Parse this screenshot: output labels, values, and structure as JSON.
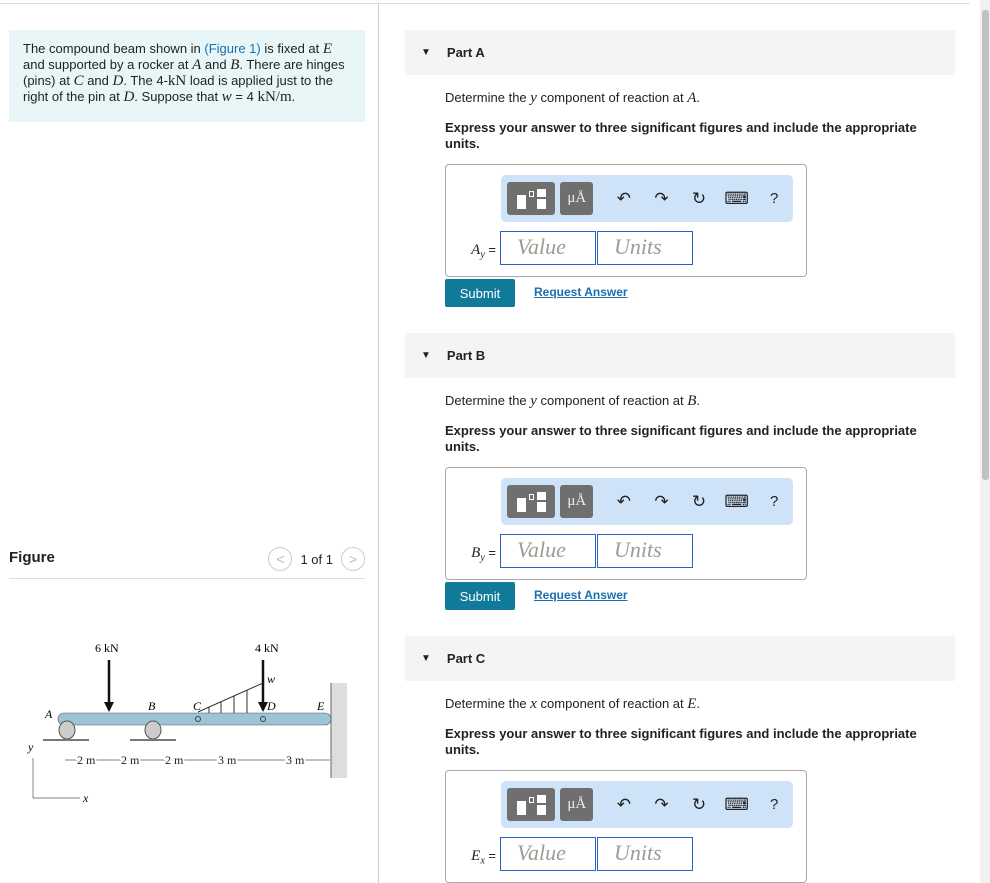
{
  "intro": {
    "t1": "The compound beam shown in ",
    "link": "(Figure 1)",
    "t2": " is fixed at ",
    "E": "E",
    "t3": " and supported by a rocker at ",
    "A": "A",
    "t4": " and ",
    "B": "B",
    "t5": ". There are hinges (pins) at ",
    "C": "C",
    "t6": " and ",
    "D": "D",
    "t7": ". The 4-",
    "kN": "kN",
    "t8": " load is applied just to the right of the pin at ",
    "D2": "D",
    "t9": ". Suppose that ",
    "w": "w",
    "t10": " = 4 ",
    "unit": "kN/m",
    "t11": "."
  },
  "figure": {
    "label": "Figure",
    "page": "1 of 1",
    "prev": "<",
    "next": ">",
    "labels": {
      "f1": "6 kN",
      "f2": "4 kN",
      "w": "w",
      "A": "A",
      "B": "B",
      "C": "C",
      "D": "D",
      "E": "E",
      "y": "y",
      "x": "x",
      "d1": "2 m",
      "d2": "2 m",
      "d3": "2 m",
      "d4": "3 m",
      "d5": "3 m"
    }
  },
  "parts": [
    {
      "title": "Part A",
      "question_pre": "Determine the ",
      "var": "y",
      "question_mid": " component of reaction at ",
      "point": "A",
      "question_end": ".",
      "express": "Express your answer to three significant figures and include the appropriate units.",
      "label_sym": "A",
      "label_sub": "y",
      "value_placeholder": "Value",
      "units_placeholder": "Units",
      "submit": "Submit",
      "request": "Request Answer"
    },
    {
      "title": "Part B",
      "question_pre": "Determine the ",
      "var": "y",
      "question_mid": " component of reaction at ",
      "point": "B",
      "question_end": ".",
      "express": "Express your answer to three significant figures and include the appropriate units.",
      "label_sym": "B",
      "label_sub": "y",
      "value_placeholder": "Value",
      "units_placeholder": "Units",
      "submit": "Submit",
      "request": "Request Answer"
    },
    {
      "title": "Part C",
      "question_pre": "Determine the ",
      "var": "x",
      "question_mid": " component of reaction at ",
      "point": "E",
      "question_end": ".",
      "express": "Express your answer to three significant figures and include the appropriate units.",
      "label_sym": "E",
      "label_sub": "x",
      "value_placeholder": "Value",
      "units_placeholder": "Units"
    }
  ],
  "toolbar": {
    "mu": "μÅ",
    "undo": "↶",
    "redo": "↷",
    "reset": "↻",
    "keyboard": "⌨",
    "help": "?"
  },
  "colors": {
    "submit": "#107b99",
    "link": "#1a6fb0",
    "intro_bg": "#e9f6f7",
    "toolbar_bg": "#cfe3f8",
    "beam": "#9cc4d4"
  }
}
